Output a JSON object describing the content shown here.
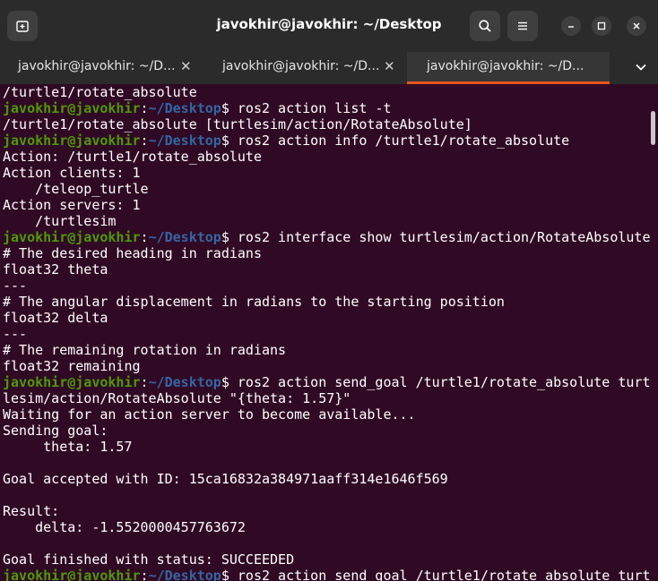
{
  "window": {
    "title": "javokhir@javokhir: ~/Desktop",
    "tabs": [
      {
        "label": "javokhir@javokhir: ~/D...",
        "active": false
      },
      {
        "label": "javokhir@javokhir: ~/D...",
        "active": false
      },
      {
        "label": "javokhir@javokhir: ~/D...",
        "active": true
      }
    ],
    "close_glyph": "✕"
  },
  "colors": {
    "background": "#300a24",
    "user": "#4e9a06",
    "path": "#3465a4",
    "text": "#ffffff",
    "tab_accent": "#e95420",
    "chrome": "#2b2b2b"
  },
  "icons": [
    "new-tab-icon",
    "search-icon",
    "hamburger-menu-icon",
    "minimize-icon",
    "maximize-icon",
    "close-icon",
    "chevron-down-icon"
  ],
  "terminal": {
    "lines": [
      {
        "text": "/turtle1/rotate_absolute"
      },
      {
        "user": "javokhir@javokhir",
        "path": "~/Desktop",
        "cmd": "ros2 action list -t"
      },
      {
        "text": "/turtle1/rotate_absolute [turtlesim/action/RotateAbsolute]"
      },
      {
        "user": "javokhir@javokhir",
        "path": "~/Desktop",
        "cmd": "ros2 action info /turtle1/rotate_absolute"
      },
      {
        "text": "Action: /turtle1/rotate_absolute"
      },
      {
        "text": "Action clients: 1"
      },
      {
        "text": "    /teleop_turtle"
      },
      {
        "text": "Action servers: 1"
      },
      {
        "text": "    /turtlesim"
      },
      {
        "user": "javokhir@javokhir",
        "path": "~/Desktop",
        "cmd": "ros2 interface show turtlesim/action/RotateAbsolute"
      },
      {
        "text": "# The desired heading in radians"
      },
      {
        "text": "float32 theta"
      },
      {
        "text": "---"
      },
      {
        "text": "# The angular displacement in radians to the starting position"
      },
      {
        "text": "float32 delta"
      },
      {
        "text": "---"
      },
      {
        "text": "# The remaining rotation in radians"
      },
      {
        "text": "float32 remaining"
      },
      {
        "user": "javokhir@javokhir",
        "path": "~/Desktop",
        "cmd": "ros2 action send_goal /turtle1/rotate_absolute turt"
      },
      {
        "text": "lesim/action/RotateAbsolute \"{theta: 1.57}\""
      },
      {
        "text": "Waiting for an action server to become available..."
      },
      {
        "text": "Sending goal:"
      },
      {
        "text": "     theta: 1.57"
      },
      {
        "text": ""
      },
      {
        "text": "Goal accepted with ID: 15ca16832a384971aaff314e1646f569"
      },
      {
        "text": ""
      },
      {
        "text": "Result:"
      },
      {
        "text": "    delta: -1.5520000457763672"
      },
      {
        "text": ""
      },
      {
        "text": "Goal finished with status: SUCCEEDED"
      },
      {
        "user": "javokhir@javokhir",
        "path": "~/Desktop",
        "cmd": "ros2 action send_goal /turtle1/rotate_absolute turt"
      }
    ]
  }
}
